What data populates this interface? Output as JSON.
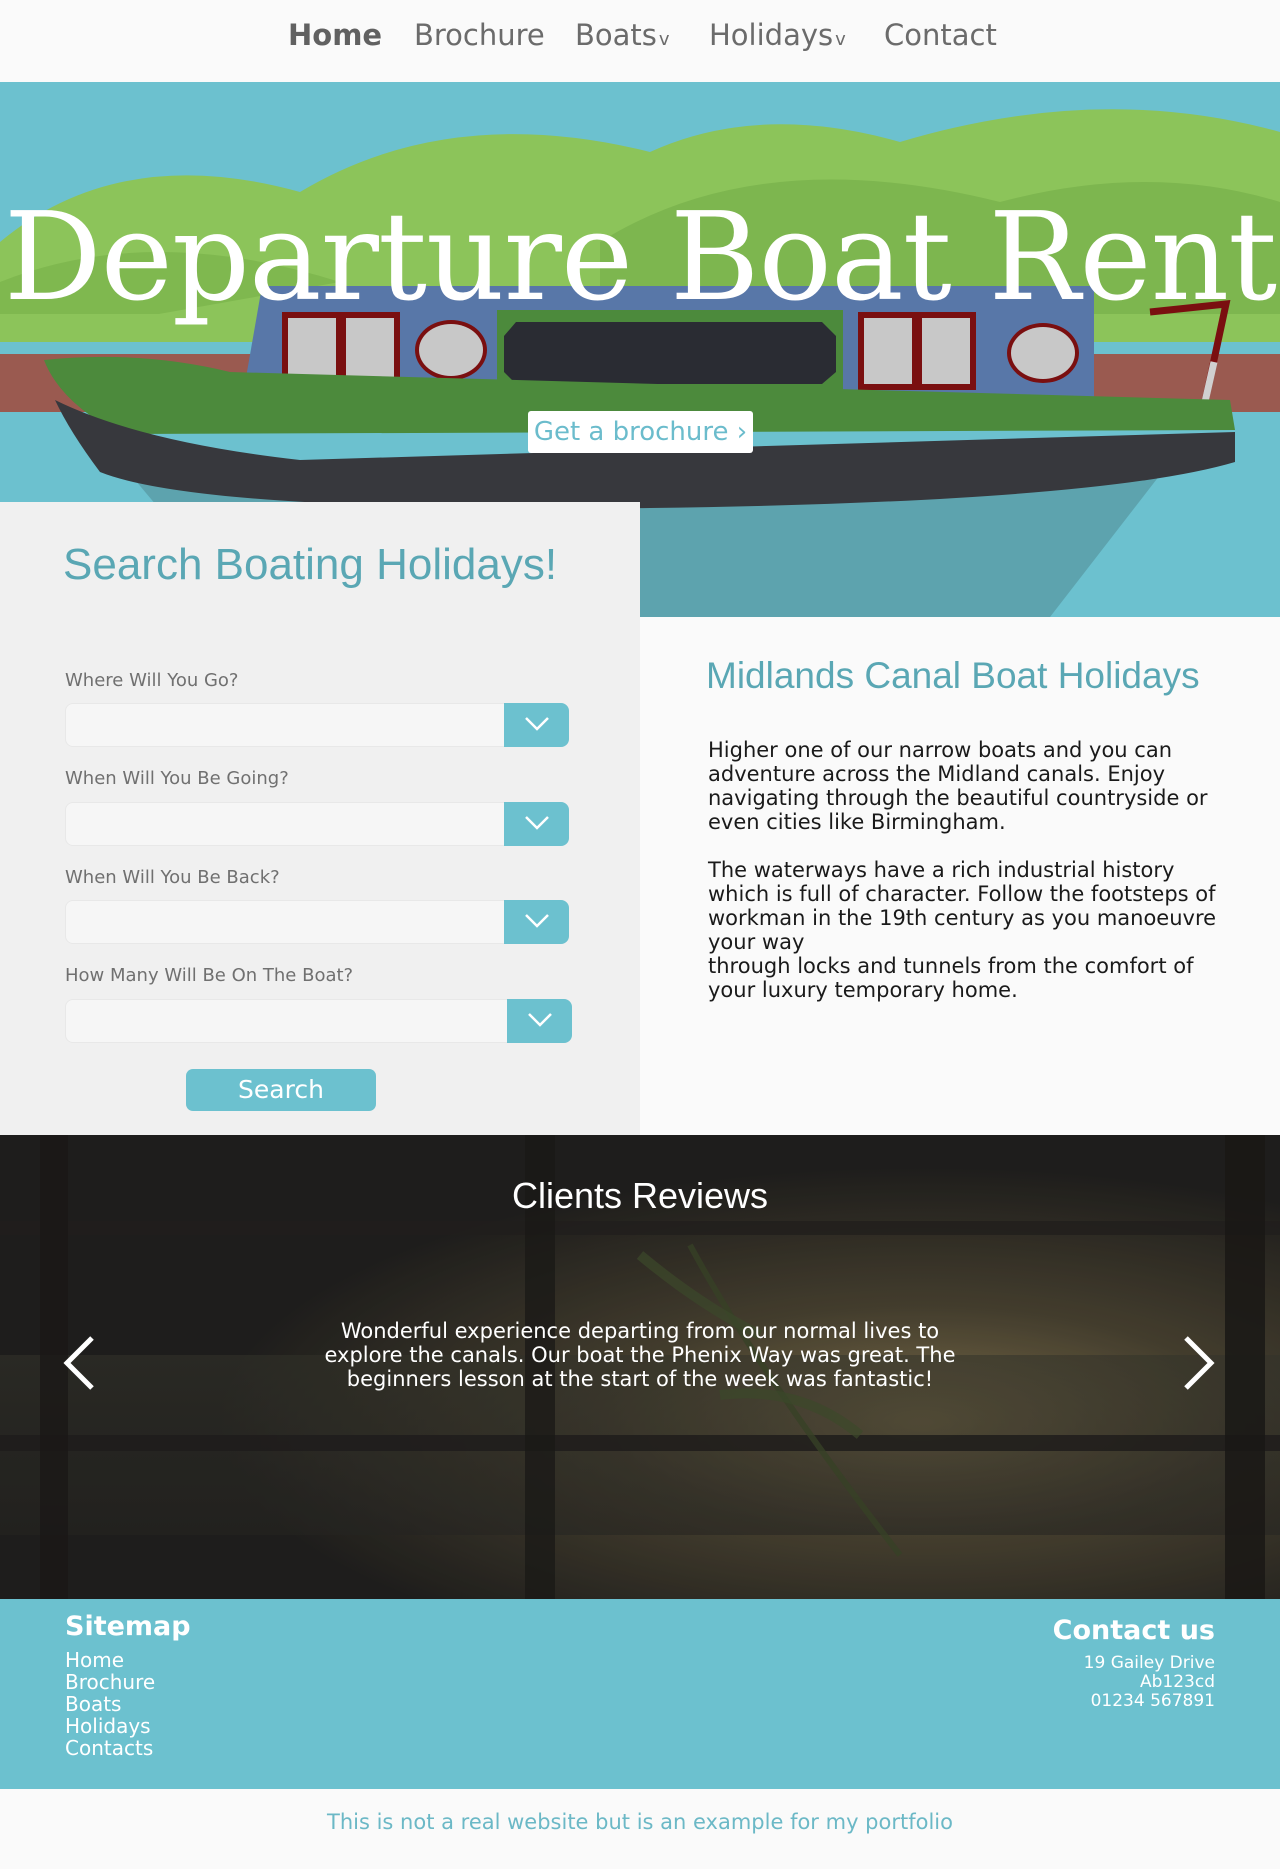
{
  "nav": {
    "items": [
      {
        "label": "Home"
      },
      {
        "label": "Brochure"
      },
      {
        "label": "Boats"
      },
      {
        "label": "Holidays"
      },
      {
        "label": "Contact"
      }
    ],
    "dropdown_glyph": "v"
  },
  "hero": {
    "title": "Departure Boat Rent",
    "brochure_button": "Get a brochure"
  },
  "search": {
    "title": "Search Boating Holidays!",
    "fields": [
      {
        "label": "Where Will You Go?",
        "value": ""
      },
      {
        "label": "When Will You Be Going?",
        "value": ""
      },
      {
        "label": "When Will You Be Back?",
        "value": ""
      },
      {
        "label": "How Many Will Be On The Boat?",
        "value": ""
      }
    ],
    "button": "Search"
  },
  "info": {
    "title": "Midlands Canal Boat Holidays",
    "paragraph1": "Higher one of our narrow boats and you can adventure across the Midland canals. Enjoy navigating through the beautiful countryside or even cities like Birmingham.",
    "paragraph2_line1": "The waterways have a rich industrial history which is full of character. Follow the footsteps of workman in the 19th century as you manoeuvre your way",
    "paragraph2_line2": "through locks and tunnels from the comfort of your luxury temporary home."
  },
  "reviews": {
    "title": "Clients Reviews",
    "text": "Wonderful experience departing from our normal lives to explore the canals. Our boat the Phenix Way was great. The beginners lesson at the start of the week was fantastic!",
    "prev_icon": "chevron-left-icon",
    "next_icon": "chevron-right-icon"
  },
  "footer": {
    "sitemap_title": "Sitemap",
    "sitemap_links": [
      "Home",
      "Brochure",
      "Boats",
      "Holidays",
      "Contacts"
    ],
    "contact_title": "Contact us",
    "contact_lines": [
      "19 Gailey Drive",
      "Ab123cd",
      "01234 567891"
    ]
  },
  "note": "This is not a real website but is an example for my portfolio",
  "colors": {
    "accent": "#6cc1cf",
    "heading": "#5aa7b4",
    "grass": "#8cc45a",
    "boat_blue": "#5877a8",
    "boat_green": "#4c8a3c",
    "hull": "#37383d"
  }
}
